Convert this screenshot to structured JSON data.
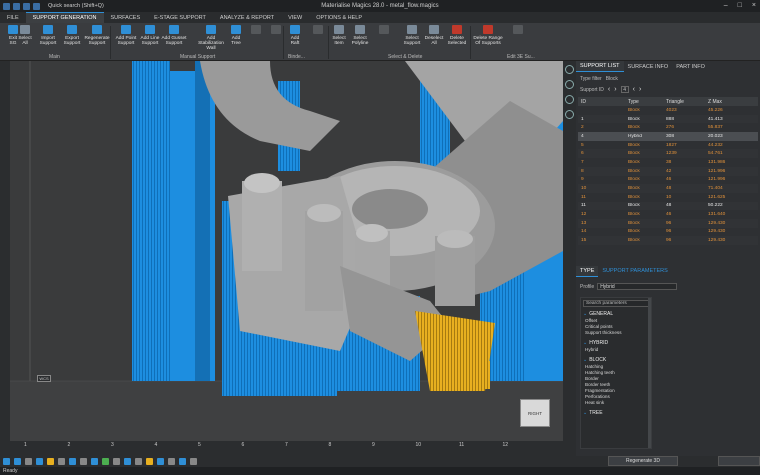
{
  "title": {
    "app": "Materialise Magics 28.0 - metal_flow.magics",
    "search": "Quick search (Shift+Q)"
  },
  "tabs": [
    {
      "label": "FILE"
    },
    {
      "label": "SUPPORT GENERATION"
    },
    {
      "label": "SURFACES"
    },
    {
      "label": "E-STAGE SUPPORT"
    },
    {
      "label": "ANALYZE & REPORT"
    },
    {
      "label": "VIEW"
    },
    {
      "label": "OPTIONS & HELP"
    }
  ],
  "ribbon": {
    "buttons": [
      {
        "label": "Exit\nSG"
      },
      {
        "label": "Select\nAll"
      },
      {
        "label": "Import\nSupport"
      },
      {
        "label": "Export\nSupport"
      },
      {
        "label": "Regenerate\nSupport"
      },
      {
        "label": "Add Point\nSupport"
      },
      {
        "label": "Add Line\nSupport"
      },
      {
        "label": "Add Gusset\nSupport"
      },
      {
        "label": "Add Stabilization\nWall"
      },
      {
        "label": "Add\nTree"
      },
      {
        "label": "Add\nRaft"
      },
      {
        "label": "Select\nItem"
      },
      {
        "label": "Select\nPolyline"
      },
      {
        "label": "Select\nSupport"
      },
      {
        "label": "Deselect\nAll"
      },
      {
        "label": "Delete\nSelected"
      },
      {
        "label": "Delete Range\nOf Supports"
      }
    ],
    "groups": {
      "main": "Main",
      "manual": "Manual Support",
      "bind": "Binde...",
      "select": "Select & Delete",
      "edit": "Edit 3E Su..."
    }
  },
  "support_panel": {
    "tabs": [
      "SUPPORT LIST",
      "SURFACE INFO",
      "PART INFO"
    ],
    "type_filter_label": "Type filter",
    "type_filter_value": "Block",
    "support_id_label": "Support ID",
    "support_id_value": "4",
    "columns": [
      "ID",
      "Type",
      "Triangle",
      "Z Max"
    ],
    "rows": [
      {
        "id": "",
        "type": "Block",
        "triangle": "4023",
        "zmax": "45.226",
        "color": "orange"
      },
      {
        "id": "1",
        "type": "Block",
        "triangle": "888",
        "zmax": "41.413",
        "color": "white"
      },
      {
        "id": "2",
        "type": "Block",
        "triangle": "276",
        "zmax": "55.837",
        "color": "orange"
      },
      {
        "id": "4",
        "type": "Hybrid",
        "triangle": "308",
        "zmax": "20.023",
        "color": "selected"
      },
      {
        "id": "5",
        "type": "Block",
        "triangle": "1827",
        "zmax": "44.232",
        "color": "orange"
      },
      {
        "id": "6",
        "type": "Block",
        "triangle": "1239",
        "zmax": "54.761",
        "color": "orange"
      },
      {
        "id": "7",
        "type": "Block",
        "triangle": "38",
        "zmax": "131.986",
        "color": "orange"
      },
      {
        "id": "8",
        "type": "Block",
        "triangle": "42",
        "zmax": "121.996",
        "color": "orange"
      },
      {
        "id": "9",
        "type": "Block",
        "triangle": "46",
        "zmax": "121.996",
        "color": "orange"
      },
      {
        "id": "10",
        "type": "Block",
        "triangle": "48",
        "zmax": "71.404",
        "color": "orange"
      },
      {
        "id": "11",
        "type": "Block",
        "triangle": "10",
        "zmax": "121.625",
        "color": "orange"
      },
      {
        "id": "11",
        "type": "Block",
        "triangle": "48",
        "zmax": "50.222",
        "color": "white"
      },
      {
        "id": "12",
        "type": "Block",
        "triangle": "46",
        "zmax": "131.640",
        "color": "orange"
      },
      {
        "id": "13",
        "type": "Block",
        "triangle": "96",
        "zmax": "129.430",
        "color": "orange"
      },
      {
        "id": "14",
        "type": "Block",
        "triangle": "96",
        "zmax": "129.430",
        "color": "orange"
      },
      {
        "id": "15",
        "type": "Block",
        "triangle": "96",
        "zmax": "129.430",
        "color": "orange"
      }
    ]
  },
  "params_panel": {
    "tabs": [
      "TYPE",
      "SUPPORT PARAMETERS"
    ],
    "profile_label": "Profile",
    "profile_value": "Hybrid",
    "search_placeholder": "Search parameters",
    "sections": [
      {
        "title": "GENERAL",
        "items": [
          "Offset",
          "Critical points",
          "Support thickness"
        ]
      },
      {
        "title": "HYBRID",
        "items": [
          "Hybrid"
        ]
      },
      {
        "title": "BLOCK",
        "items": [
          "Hatching",
          "Hatching teeth",
          "Border",
          "Border teeth",
          "Fragmentation",
          "Perforations",
          "Heat sink"
        ]
      },
      {
        "title": "TREE",
        "items": []
      }
    ],
    "regenerate_label": "Regenerate 3D"
  },
  "viewport": {
    "wcs_label": "WCS",
    "view_label": "RIGHT"
  },
  "ruler": [
    "1",
    "2",
    "3",
    "4",
    "5",
    "6",
    "7",
    "8",
    "9",
    "10",
    "11",
    "12"
  ],
  "status": "Ready",
  "colors": {
    "accent": "#2f8fd6",
    "support_blue": "#1d8ee0",
    "part_gray": "#9a9a9a",
    "hybrid_orange": "#e8b020"
  }
}
